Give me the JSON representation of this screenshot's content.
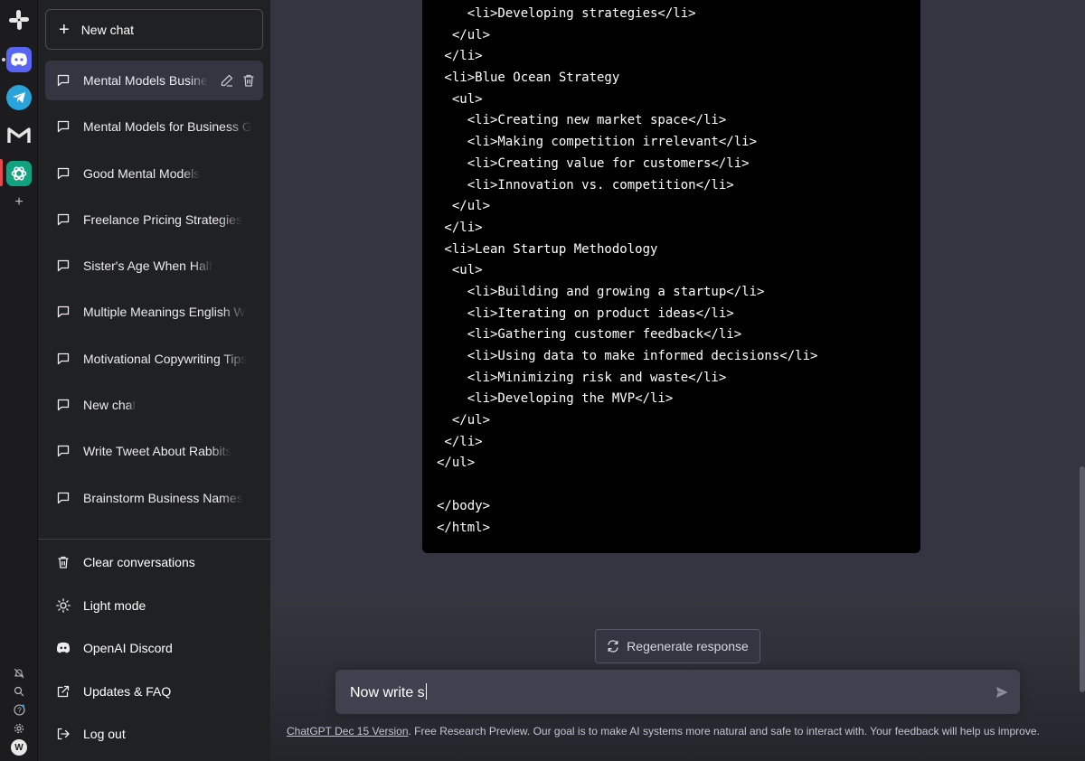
{
  "sidebar": {
    "new_chat_label": "New chat",
    "conversations": [
      {
        "title": "Mental Models Busine",
        "active": true
      },
      {
        "title": "Mental Models for Business G"
      },
      {
        "title": "Good Mental Models"
      },
      {
        "title": "Freelance Pricing Strategies"
      },
      {
        "title": "Sister's Age When Half"
      },
      {
        "title": "Multiple Meanings English W"
      },
      {
        "title": "Motivational Copywriting Tips"
      },
      {
        "title": "New chat"
      },
      {
        "title": "Write Tweet About Rabbits"
      },
      {
        "title": "Brainstorm Business Names"
      }
    ],
    "bottom": {
      "clear": "Clear conversations",
      "light_mode": "Light mode",
      "discord": "OpenAI Discord",
      "updates": "Updates & FAQ",
      "logout": "Log out"
    }
  },
  "code_lines": [
    "    <li>Developing strategies</li>",
    "  </ul>",
    " </li>",
    " <li>Blue Ocean Strategy",
    "  <ul>",
    "    <li>Creating new market space</li>",
    "    <li>Making competition irrelevant</li>",
    "    <li>Creating value for customers</li>",
    "    <li>Innovation vs. competition</li>",
    "  </ul>",
    " </li>",
    " <li>Lean Startup Methodology",
    "  <ul>",
    "    <li>Building and growing a startup</li>",
    "    <li>Iterating on product ideas</li>",
    "    <li>Gathering customer feedback</li>",
    "    <li>Using data to make informed decisions</li>",
    "    <li>Minimizing risk and waste</li>",
    "    <li>Developing the MVP</li>",
    "  </ul>",
    " </li>",
    "</ul>",
    "",
    "</body>",
    "</html>"
  ],
  "regenerate_label": "Regenerate response",
  "input": {
    "value": "Now write s"
  },
  "footer": {
    "link": "ChatGPT Dec 15 Version",
    "text": ". Free Research Preview. Our goal is to make AI systems more natural and safe to interact with. Your feedback will help us improve."
  },
  "colors": {
    "sidebar_bg": "#202123",
    "main_bg": "#343541",
    "code_bg": "#000000",
    "input_bg": "#40414f",
    "chatgpt_green": "#10a37f",
    "discord_blurple": "#5865f2",
    "telegram_blue": "#2aa3db"
  },
  "rail": {
    "apps": [
      "slack-icon",
      "discord-icon",
      "telegram-icon",
      "gmail-icon",
      "chatgpt-icon",
      "add-app-icon"
    ],
    "bottom_icons": [
      "notifications-off-icon",
      "search-icon",
      "help-icon",
      "settings-icon",
      "workspace-icon"
    ],
    "workspace_letter": "W",
    "help_glyph": "?"
  }
}
